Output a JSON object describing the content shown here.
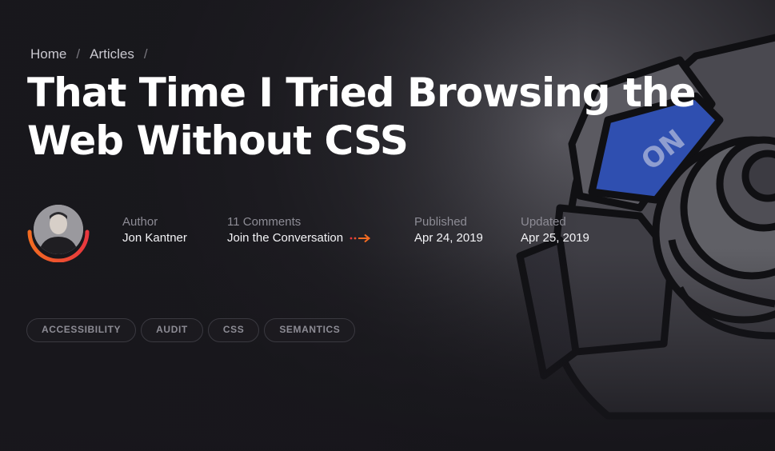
{
  "breadcrumb": {
    "items": [
      "Home",
      "Articles"
    ],
    "separator": "/"
  },
  "article": {
    "title": "That Time I Tried Browsing the Web Without CSS"
  },
  "hero": {
    "switch_label": "ON"
  },
  "meta": {
    "author": {
      "label": "Author",
      "value": "Jon Kantner"
    },
    "comments": {
      "label": "11 Comments",
      "value": "Join the Conversation",
      "icon": "arrow-right-icon"
    },
    "published": {
      "label": "Published",
      "value": "Apr 24, 2019"
    },
    "updated": {
      "label": "Updated",
      "value": "Apr 25, 2019"
    }
  },
  "tags": [
    "ACCESSIBILITY",
    "AUDIT",
    "CSS",
    "SEMANTICS"
  ],
  "colors": {
    "background": "#1c1b20",
    "accent_orange": "#f26b21",
    "accent_red": "#e8373e",
    "switch_blue": "#2f4fb0",
    "muted_text": "#8d8c95"
  }
}
